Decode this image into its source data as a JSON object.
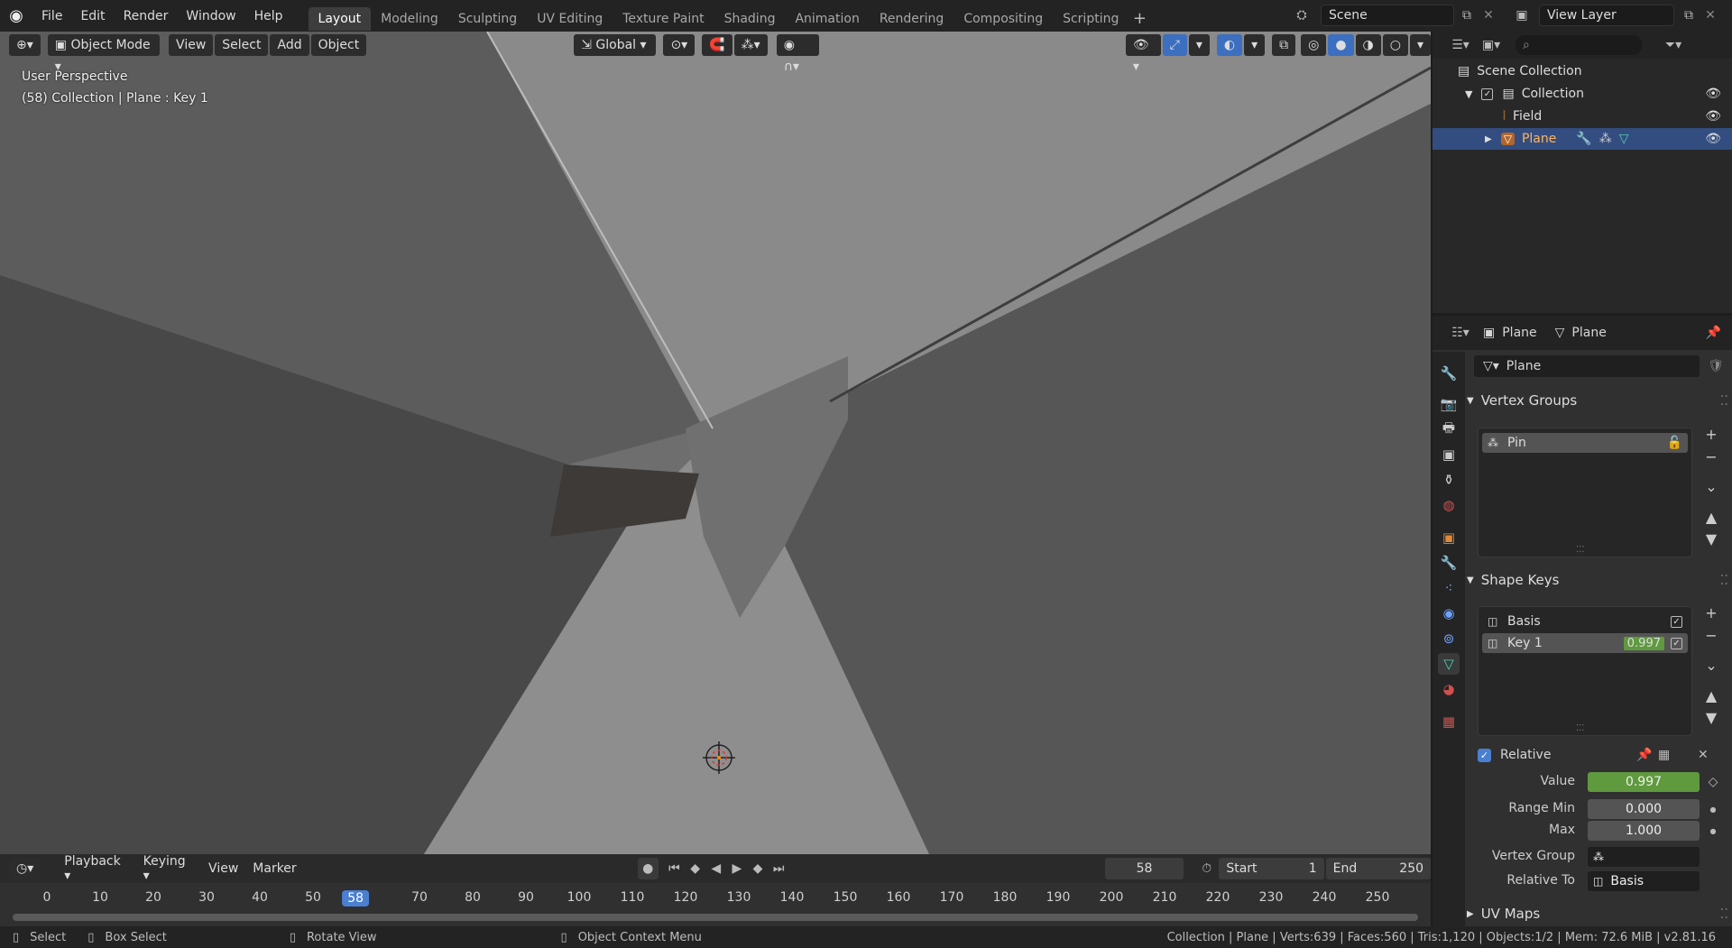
{
  "menu": [
    "File",
    "Edit",
    "Render",
    "Window",
    "Help"
  ],
  "workspaces": [
    "Layout",
    "Modeling",
    "Sculpting",
    "UV Editing",
    "Texture Paint",
    "Shading",
    "Animation",
    "Rendering",
    "Compositing",
    "Scripting"
  ],
  "active_workspace": "Layout",
  "scene_name": "Scene",
  "view_layer": "View Layer",
  "viewport": {
    "mode": "Object Mode",
    "view": "View",
    "select": "Select",
    "add": "Add",
    "object": "Object",
    "orientation": "Global",
    "perspective_label": "User Perspective",
    "context_label": "(58) Collection | Plane : Key 1"
  },
  "timeline": {
    "playback": "Playback",
    "keying": "Keying",
    "view": "View",
    "marker": "Marker",
    "current_frame": "58",
    "start_label": "Start",
    "start": "1",
    "end_label": "End",
    "end": "250",
    "frames": [
      "0",
      "10",
      "20",
      "30",
      "40",
      "50",
      "58",
      "70",
      "80",
      "90",
      "100",
      "110",
      "120",
      "130",
      "140",
      "150",
      "160",
      "170",
      "180",
      "190",
      "200",
      "210",
      "220",
      "230",
      "240",
      "250"
    ]
  },
  "outliner": {
    "scene_collection": "Scene Collection",
    "collection": "Collection",
    "items": [
      "Field",
      "Plane"
    ]
  },
  "properties": {
    "object_name": "Plane",
    "data_name": "Plane",
    "mesh_name": "Plane",
    "vertex_groups_title": "Vertex Groups",
    "vertex_group_item": "Pin",
    "shape_keys_title": "Shape Keys",
    "shape_keys": [
      {
        "name": "Basis",
        "value": ""
      },
      {
        "name": "Key 1",
        "value": "0.997"
      }
    ],
    "relative_label": "Relative",
    "value_label": "Value",
    "value": "0.997",
    "range_min_label": "Range Min",
    "range_min": "0.000",
    "max_label": "Max",
    "max": "1.000",
    "vertex_group_label": "Vertex Group",
    "relative_to_label": "Relative To",
    "relative_to": "Basis",
    "uv_maps_title": "UV Maps"
  },
  "status": {
    "select": "Select",
    "box_select": "Box Select",
    "rotate_view": "Rotate View",
    "context_menu": "Object Context Menu",
    "stats": "Collection | Plane | Verts:639 | Faces:560 | Tris:1,120 | Objects:1/2 | Mem: 72.6 MiB | v2.81.16"
  }
}
